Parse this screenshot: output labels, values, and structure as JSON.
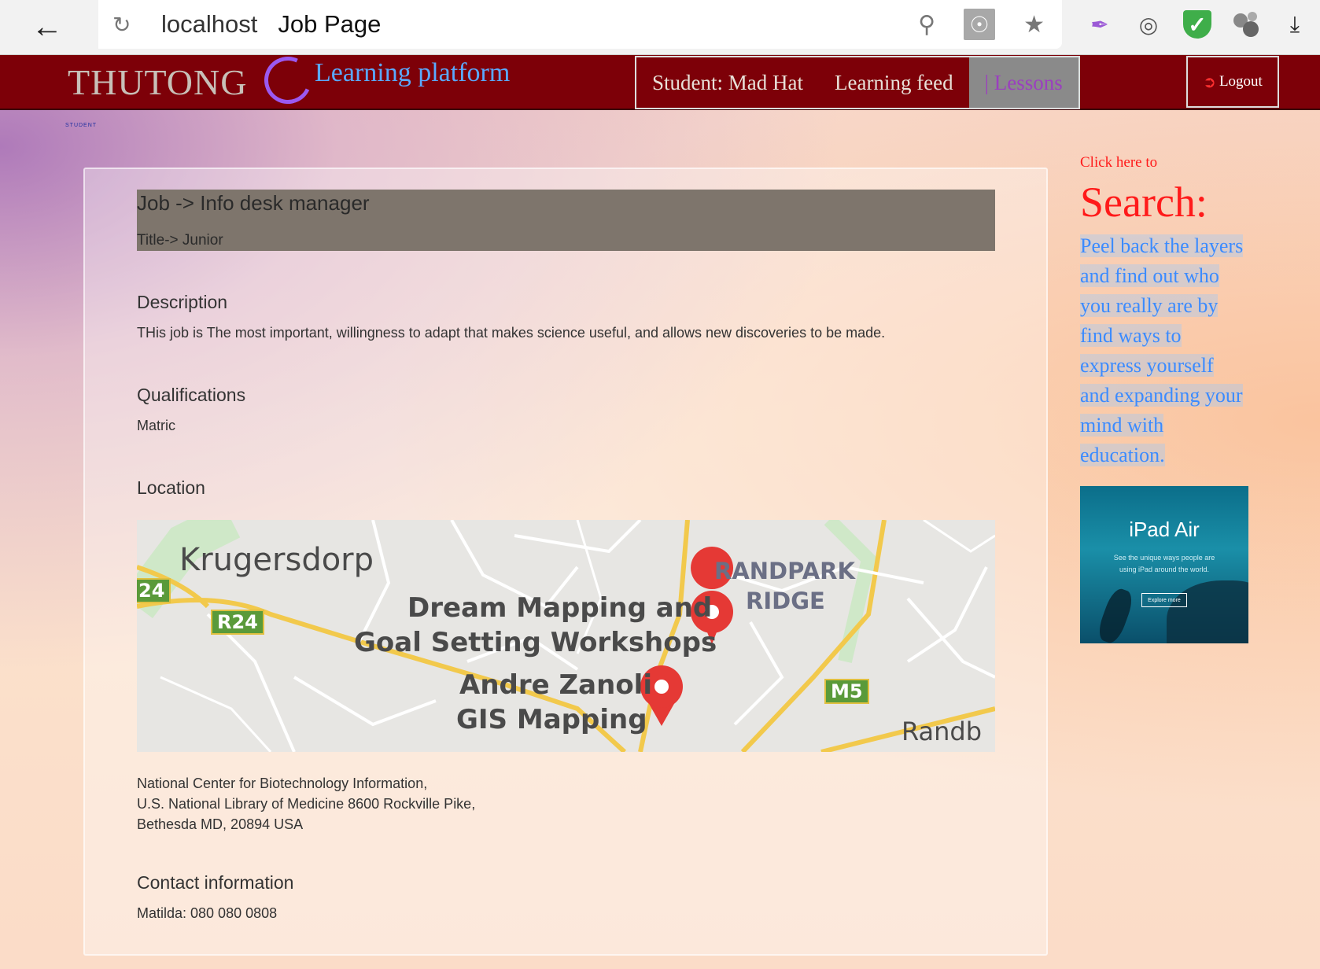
{
  "browser": {
    "host": "localhost",
    "tab_title": "Job Page"
  },
  "nav": {
    "brand": "THUTONG",
    "brand_sub": "Learning platform",
    "tagline": "STUDENT",
    "items": [
      {
        "label": "Student: Mad Hat",
        "active": false
      },
      {
        "label": "Learning feed",
        "active": false
      },
      {
        "label": "| Lessons",
        "active": true
      }
    ],
    "logout": "Logout"
  },
  "job": {
    "title": "Job -> Info desk manager",
    "subtitle": "Title-> Junior",
    "description_heading": "Description",
    "description": "THis job is The most important, willingness to adapt that makes science useful, and allows new discoveries to be made.",
    "qualifications_heading": "Qualifications",
    "qualifications": "Matric",
    "location_heading": "Location",
    "address_line1": "National Center for Biotechnology Information,",
    "address_line2": "U.S. National Library of Medicine 8600 Rockville Pike,",
    "address_line3": "Bethesda MD, 20894 USA",
    "contact_heading": "Contact information",
    "contact": "Matilda: 080 080 0808"
  },
  "map": {
    "labels": {
      "krugersdorp": "Krugersdorp",
      "randpark1": "RANDPARK",
      "randpark2": "RIDGE",
      "dream1": "Dream Mapping and",
      "dream2": "Goal Setting Workshops",
      "andre1": "Andre Zanoli",
      "andre2": "GIS Mapping",
      "randb": "Randb",
      "r24": "R24",
      "r24b": "24",
      "m5": "M5"
    },
    "pin_color": "#e53935"
  },
  "sidebar": {
    "click": "Click here to",
    "search": "Search:",
    "peel": [
      "Peel back the layers",
      "and find out who",
      "you really are by",
      "find ways to",
      "express yourself",
      "and expanding your",
      "mind with",
      "education."
    ],
    "ad_title": " iPad Air",
    "ad_text_1": "See the unique ways people are",
    "ad_text_2": "using iPad around the world.",
    "ad_button": "Explore more"
  },
  "colors": {
    "nav_bg": "#7d0008",
    "accent_red": "#ff1a1a",
    "link_blue": "#3b8bff"
  }
}
